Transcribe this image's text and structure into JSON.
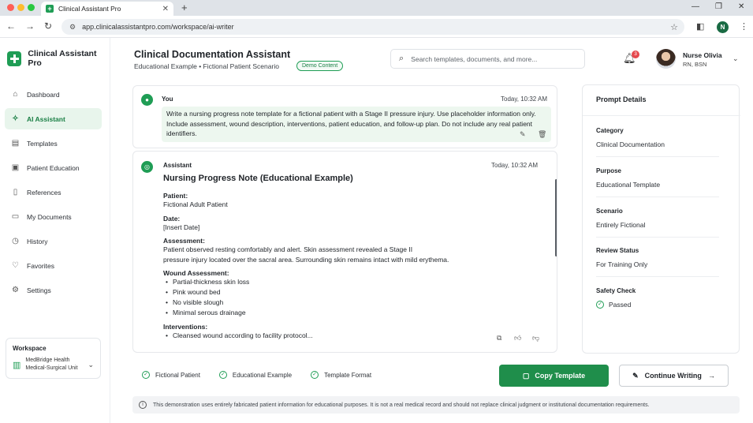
{
  "browser": {
    "tab_title": "Clinical Assistant Pro",
    "url": "app.clinicalassistantpro.com/workspace/ai-writer",
    "profile_initial": "N",
    "traffic_colors": [
      "#ff5f57",
      "#febc2e",
      "#28c840"
    ]
  },
  "brand": {
    "name": "Clinical Assistant Pro",
    "color": "#1f9d55"
  },
  "sidebar": {
    "items": [
      {
        "label": "Dashboard",
        "icon": "home-icon"
      },
      {
        "label": "AI Assistant",
        "icon": "sparkle-icon",
        "active": true
      },
      {
        "label": "Templates",
        "icon": "document-icon"
      },
      {
        "label": "Patient Education",
        "icon": "clipboard-icon"
      },
      {
        "label": "References",
        "icon": "book-icon"
      },
      {
        "label": "My Documents",
        "icon": "file-icon"
      },
      {
        "label": "History",
        "icon": "clock-icon"
      },
      {
        "label": "Favorites",
        "icon": "heart-icon"
      },
      {
        "label": "Settings",
        "icon": "gear-icon"
      }
    ],
    "workspace": {
      "label": "Workspace",
      "org": "MedBridge Health",
      "unit": "Medical-Surgical Unit"
    }
  },
  "header": {
    "title": "Clinical Documentation Assistant",
    "subtitle": "Educational Example • Fictional Patient Scenario",
    "badge": "Demo Content",
    "search_placeholder": "Search templates, documents, and more...",
    "notification_count": "3",
    "user_name": "Nurse Olivia",
    "user_role": "RN, BSN"
  },
  "conversation": {
    "user": {
      "name": "You",
      "time": "Today, 10:32 AM",
      "message": "Write a nursing progress note template for a fictional patient with a Stage II pressure injury. Use placeholder information only. Include assessment, wound description, interventions, patient education, and follow-up plan. Do not include any real patient identifiers."
    },
    "assistant": {
      "name": "Assistant",
      "time": "Today, 10:32 AM",
      "note_title": "Nursing Progress Note (Educational Example)",
      "patient_label": "Patient:",
      "patient_value": "Fictional Adult Patient",
      "date_label": "Date:",
      "date_value": "[Insert Date]",
      "assessment_label": "Assessment:",
      "assessment_line1": "Patient observed resting comfortably and alert. Skin assessment revealed a Stage II",
      "assessment_line2": "pressure injury located over the sacral area. Surrounding skin remains intact with mild erythema.",
      "wound_label": "Wound Assessment:",
      "wound_items": [
        "Partial-thickness skin loss",
        "Pink wound bed",
        "No visible slough",
        "Minimal serous drainage"
      ],
      "interventions_label": "Interventions:",
      "interventions_items": [
        "Cleansed wound according to facility protocol..."
      ]
    }
  },
  "details": {
    "heading": "Prompt Details",
    "category_label": "Category",
    "category_value": "Clinical Documentation",
    "purpose_label": "Purpose",
    "purpose_value": "Educational Template",
    "scenario_label": "Scenario",
    "scenario_value": "Entirely Fictional",
    "review_label": "Review Status",
    "review_value": "For Training Only",
    "safety_label": "Safety Check",
    "safety_value": "Passed"
  },
  "footer": {
    "tags": [
      "Fictional Patient",
      "Educational Example",
      "Template Format"
    ],
    "copy_label": "Copy Template",
    "continue_label": "Continue Writing",
    "disclaimer": "This demonstration uses entirely fabricated patient information for educational purposes. It is not a real medical record and should not replace clinical judgment or institutional documentation requirements."
  },
  "colors": {
    "accent": "#1f8e4b",
    "active_bg": "#e8f5ec",
    "notification": "#e5484d"
  }
}
